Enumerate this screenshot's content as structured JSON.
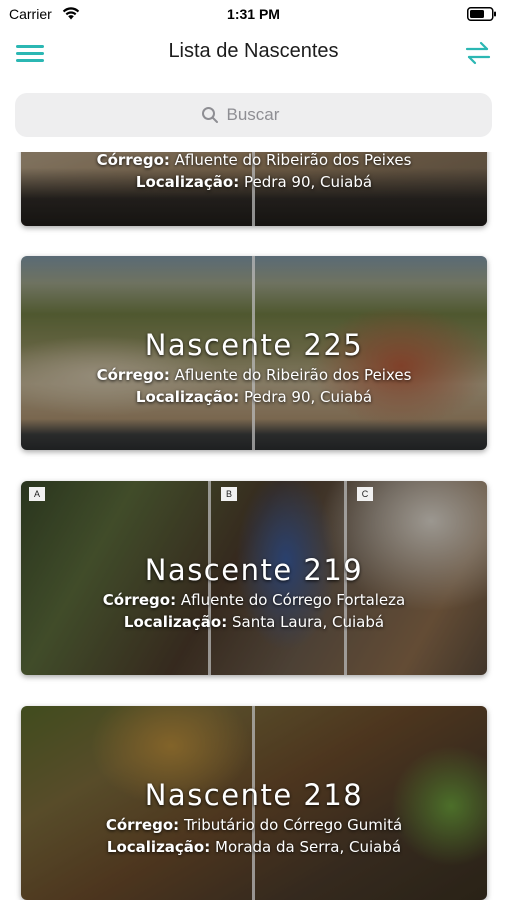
{
  "status_bar": {
    "carrier": "Carrier",
    "time": "1:31 PM"
  },
  "nav": {
    "title": "Lista de Nascentes",
    "menu_icon": "hamburger-menu-icon",
    "swap_icon": "swap-arrows-icon",
    "accent_color": "#2bb7b3"
  },
  "search": {
    "placeholder": "Buscar"
  },
  "labels": {
    "corrego": "Córrego:",
    "localizacao": "Localização:"
  },
  "cards": [
    {
      "title": "",
      "corrego": "Afluente do Ribeirão dos Peixes",
      "localizacao": "Pedra 90, Cuiabá"
    },
    {
      "title": "Nascente 225",
      "corrego": "Afluente do Ribeirão dos Peixes",
      "localizacao": "Pedra 90, Cuiabá"
    },
    {
      "title": "Nascente 219",
      "corrego": "Afluente do Córrego Fortaleza",
      "localizacao": "Santa Laura, Cuiabá",
      "panel_letters": [
        "A",
        "B",
        "C"
      ]
    },
    {
      "title": "Nascente 218",
      "corrego": "Tributário do Córrego Gumitá",
      "localizacao": "Morada da Serra, Cuiabá"
    }
  ]
}
